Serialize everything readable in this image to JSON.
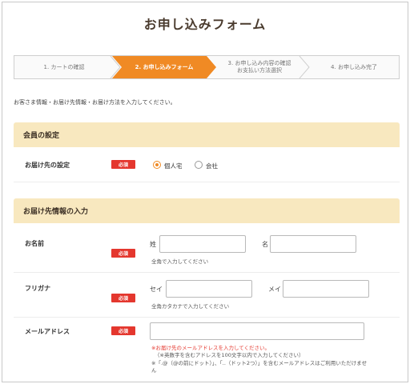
{
  "page": {
    "title": "お申し込みフォーム",
    "intro": "お客さま情報・お届け先情報・お届け方法を入力してください。"
  },
  "steps": [
    {
      "label": "1. カートの確認",
      "active": false
    },
    {
      "label": "2. お申し込みフォーム",
      "active": true
    },
    {
      "label_line1": "3. お申し込み内容の確認",
      "label_line2": "お支払い方法選択",
      "active": false
    },
    {
      "label": "4. お申し込み完了",
      "active": false
    }
  ],
  "colors": {
    "accent": "#f08a24",
    "required": "#e4372e",
    "section_bg": "#f8e8bf"
  },
  "member": {
    "heading": "会員の設定",
    "row_label": "お届け先の設定",
    "required": "必須",
    "options": [
      {
        "label": "個人宅",
        "checked": true
      },
      {
        "label": "会社",
        "checked": false
      }
    ]
  },
  "delivery": {
    "heading": "お届け先情報の入力",
    "name": {
      "label": "お名前",
      "required": "必須",
      "last_prefix": "姓",
      "first_prefix": "名",
      "last_value": "",
      "first_value": "",
      "hint": "全角で入力してください"
    },
    "kana": {
      "label": "フリガナ",
      "required": "必須",
      "last_prefix": "セイ",
      "first_prefix": "メイ",
      "last_value": "",
      "first_value": "",
      "hint": "全角カタカナで入力してください"
    },
    "email": {
      "label": "メールアドレス",
      "required": "必須",
      "value": "",
      "note_red": "※お届け先のメールアドレスを入力してください。",
      "note1": "（※英数字を含むアドレスを100文字以内で入力してください）",
      "note2": "※「.@（@の前にドット）」、「..（ドット2つ）」を含むメールアドレスはご利用いただけませ",
      "note3": "ん"
    }
  }
}
